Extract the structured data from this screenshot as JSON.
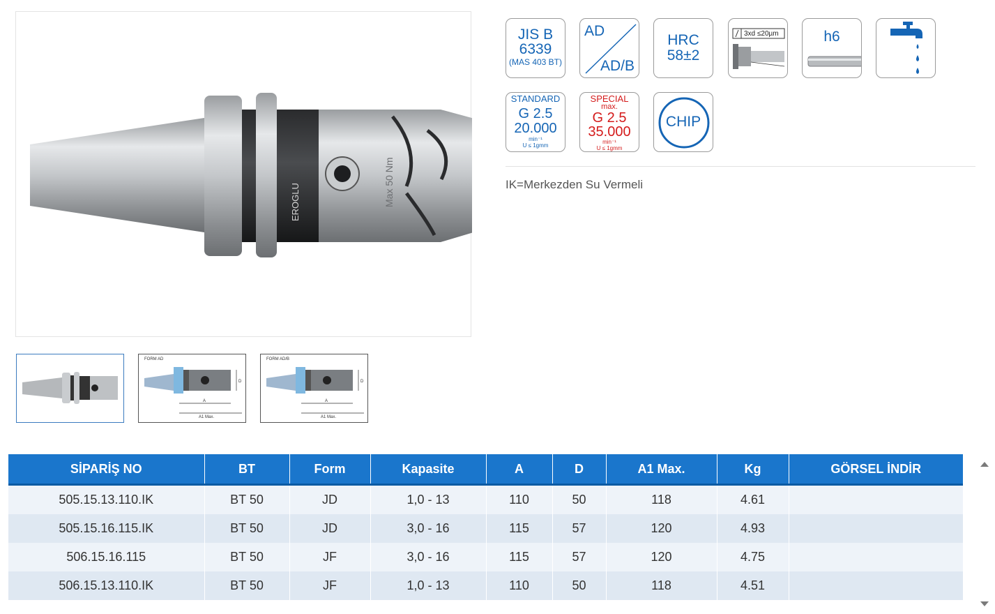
{
  "badges": {
    "jis": {
      "line1": "JIS B",
      "line2": "6339",
      "line3": "(MAS 403 BT)"
    },
    "ad": {
      "top": "AD",
      "bottom": "AD/B"
    },
    "hrc": {
      "line1": "HRC",
      "line2": "58±2"
    },
    "tolerance": {
      "label": "3xd ≤20µm"
    },
    "h6": {
      "label": "h6"
    },
    "coolant": {
      "icon": "water-tap-icon"
    },
    "standard": {
      "line1": "STANDARD",
      "line2": "G 2.5",
      "line3": "20.000",
      "line4": "min⁻¹",
      "line5": "U ≤ 1gmm"
    },
    "special": {
      "line1": "SPECIAL",
      "line2": "max.",
      "line3": "G 2.5",
      "line4": "35.000",
      "line5": "min⁻¹",
      "line6": "U ≤ 1gmm"
    },
    "chip": {
      "label": "CHIP"
    }
  },
  "product_image": {
    "brand": "EROGLU",
    "marking": "Max 50 Nm"
  },
  "thumbnails": [
    {
      "label": ""
    },
    {
      "label": "FORM AD",
      "dim_a": "A",
      "dim_a1": "A1 Max.",
      "dim_d": "D"
    },
    {
      "label": "FORM AD/B",
      "dim_a": "A",
      "dim_a1": "A1 Max.",
      "dim_d": "D"
    }
  ],
  "note": "IK=Merkezden Su Vermeli",
  "table": {
    "headers": [
      "SİPARİŞ NO",
      "BT",
      "Form",
      "Kapasite",
      "A",
      "D",
      "A1 Max.",
      "Kg",
      "GÖRSEL İNDİR"
    ],
    "rows": [
      [
        "505.15.13.110.IK",
        "BT 50",
        "JD",
        "1,0 - 13",
        "110",
        "50",
        "118",
        "4.61",
        ""
      ],
      [
        "505.15.16.115.IK",
        "BT 50",
        "JD",
        "3,0 - 16",
        "115",
        "57",
        "120",
        "4.93",
        ""
      ],
      [
        "506.15.16.115",
        "BT 50",
        "JF",
        "3,0 - 16",
        "115",
        "57",
        "120",
        "4.75",
        ""
      ],
      [
        "506.15.13.110.IK",
        "BT 50",
        "JF",
        "1,0 - 13",
        "110",
        "50",
        "118",
        "4.51",
        ""
      ]
    ]
  },
  "colors": {
    "accent": "#1a76cc",
    "badge_blue": "#1565b5",
    "badge_red": "#d41b1b"
  }
}
